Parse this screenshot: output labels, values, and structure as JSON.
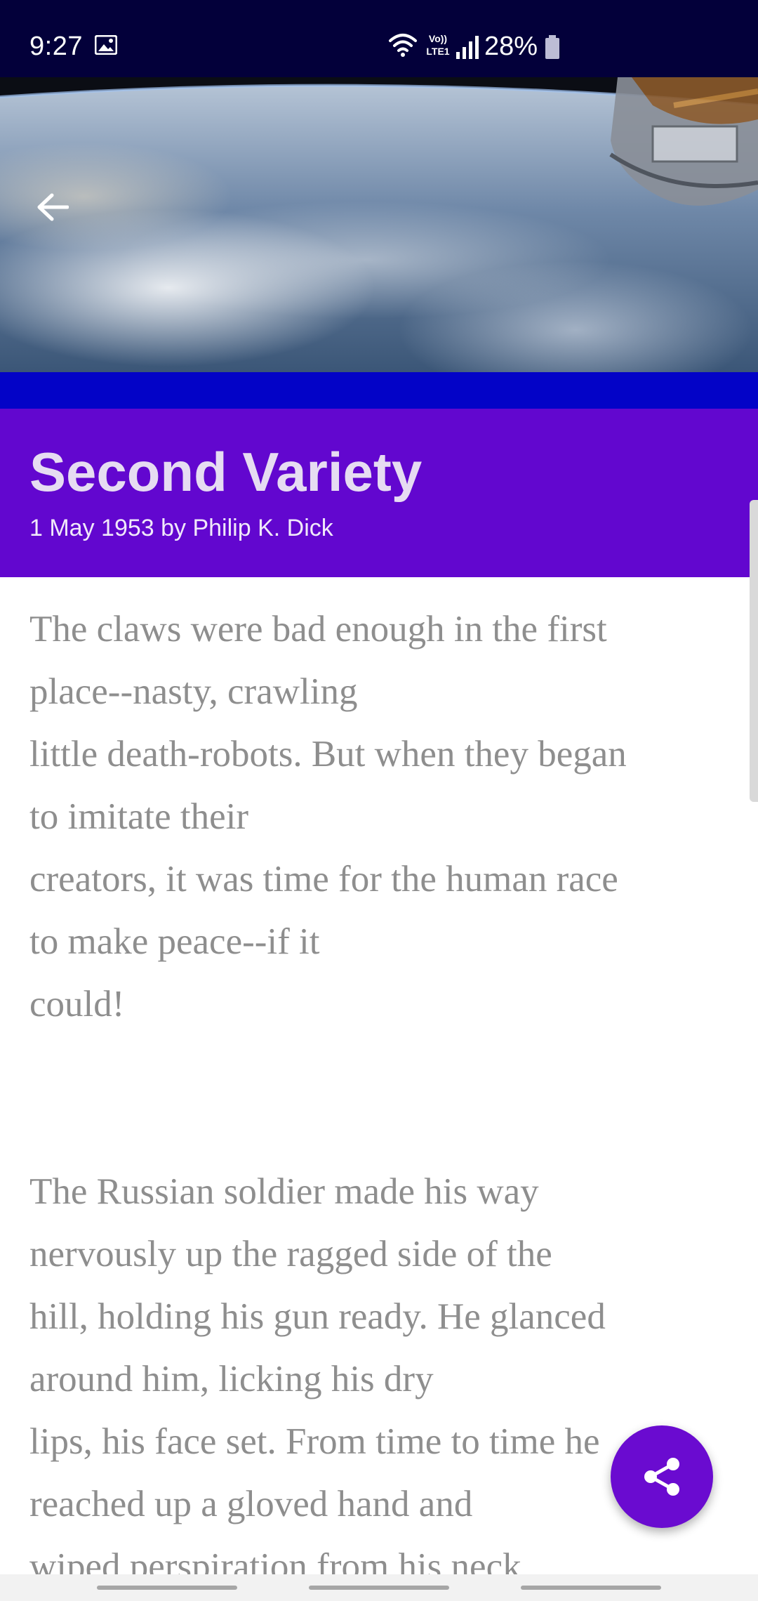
{
  "status_bar": {
    "time": "9:27",
    "battery": "28%",
    "icons": [
      "gallery-icon",
      "wifi-icon",
      "volte-lte-icon",
      "signal-icon",
      "battery-icon"
    ]
  },
  "header": {
    "hero_image": "earth-from-space-with-satellite",
    "back_icon": "arrow-left-icon"
  },
  "story": {
    "title": "Second Variety",
    "byline": "1 May 1953 by Philip K. Dick"
  },
  "article": {
    "paragraph_1": [
      "The claws were bad enough in the first",
      "place--nasty, crawling",
      "little death-robots. But when they began",
      "to imitate their",
      "creators, it was time for the human race",
      "to make peace--if it",
      "could!"
    ],
    "paragraph_2": [
      "The Russian soldier made his way",
      "nervously up the ragged side of the",
      "hill, holding his gun ready. He glanced",
      "around him, licking his dry",
      "lips, his face set. From time to time he",
      "reached up a gloved hand and",
      "wiped perspiration from his neck,"
    ]
  },
  "fab": {
    "icon": "share-icon"
  },
  "colors": {
    "status_bar": "#03003a",
    "accent_band": "#0303c7",
    "title_bg": "#6207cf",
    "fab": "#6a0bd0",
    "body_text": "#8e8e8e"
  }
}
